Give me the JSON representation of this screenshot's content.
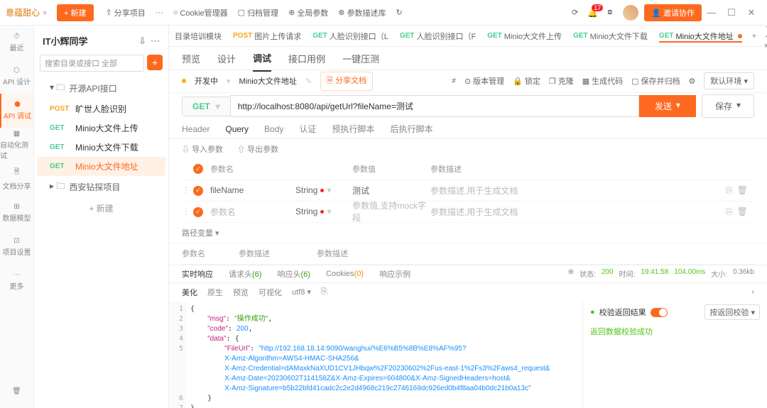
{
  "titlebar": {
    "workspace": "意蕴甜心",
    "new_btn": "新建",
    "share": "分享项目",
    "cookie": "Cookie管理器",
    "archive": "归档管理",
    "global": "全局参数",
    "paramdesc": "参数描述库",
    "notif_count": "17",
    "invite": "邀请协作"
  },
  "leftnav": {
    "recent": "最近",
    "design": "API 设计",
    "debug": "API 调试",
    "auto": "自动化测试",
    "docshare": "文档分享",
    "datamodel": "数据模型",
    "proj": "项目设置",
    "more": "更多"
  },
  "project": {
    "title": "IT小辉同学",
    "search_placeholder": "搜索目录或接口   全部",
    "folder": "开源API接口",
    "items": [
      {
        "method": "POST",
        "label": "旷世人脸识别"
      },
      {
        "method": "GET",
        "label": "Minio大文件上传"
      },
      {
        "method": "GET",
        "label": "Minio大文件下载"
      },
      {
        "method": "GET",
        "label": "Minio大文件地址"
      }
    ],
    "folder2": "西安钻探项目",
    "add": "新建"
  },
  "tabs": [
    {
      "method": "",
      "label": "目录培训模块"
    },
    {
      "method": "POST",
      "label": "图片上传请求"
    },
    {
      "method": "GET",
      "label": "人脸识别接口（L"
    },
    {
      "method": "GET",
      "label": "人脸识别接口（F"
    },
    {
      "method": "GET",
      "label": "Minio大文件上传"
    },
    {
      "method": "GET",
      "label": "Minio大文件下载"
    },
    {
      "method": "GET",
      "label": "Minio大文件地址"
    }
  ],
  "subtabs": {
    "preview": "预览",
    "design": "设计",
    "debug": "调试",
    "usecase": "接口用例",
    "press": "一键压测"
  },
  "meta": {
    "status": "开发中",
    "name": "Minio大文件地址",
    "share": "分享文档",
    "version": "版本管理",
    "lock": "锁定",
    "clone": "克隆",
    "gen": "生成代码",
    "archive": "保存并归档",
    "env": "默认环境"
  },
  "url": {
    "method": "GET",
    "value": "http://localhost:8080/api/getUrl?fileName=测试",
    "send": "发送",
    "save": "保存"
  },
  "paramtabs": {
    "header": "Header",
    "query": "Query",
    "body": "Body",
    "auth": "认证",
    "pre": "预执行脚本",
    "post": "后执行脚本"
  },
  "paramtools": {
    "import": "导入参数",
    "export": "导出参数"
  },
  "params": {
    "hd_name": "参数名",
    "hd_val": "参数值",
    "hd_desc": "参数描述",
    "rows": [
      {
        "name": "fileName",
        "type": "String",
        "val": "测试",
        "desc": "参数描述,用于生成文档"
      },
      {
        "name": "参数名",
        "type": "String",
        "val": "参数值,支持mock字段",
        "desc": "参数描述,用于生成文档"
      }
    ]
  },
  "pathvar": "路径变量",
  "secondHd": {
    "name": "参数名",
    "desc": "参数描述",
    "desc2": "参数描述"
  },
  "resulttabs": {
    "realtime": "实时响应",
    "reqhead": "请求头",
    "reqhead_n": "(6)",
    "reshead": "响应头",
    "reshead_n": "(6)",
    "cookies": "Cookies",
    "cookies_n": "(0)",
    "example": "响应示例"
  },
  "status": {
    "label": "状态:",
    "code": "200",
    "timelabel": "时间:",
    "time": "19:41:58",
    "ms": "104.00ms",
    "sizelabel": "大小:",
    "size": "0.36kb"
  },
  "viewrow": {
    "pretty": "美化",
    "raw": "原生",
    "preview": "预览",
    "visual": "可视化",
    "enc": "utf8"
  },
  "verify": {
    "head": "校验返回结果",
    "ok": "返回数据校验成功",
    "btn": "按返回校验"
  },
  "json": {
    "msg_k": "\"msg\"",
    "msg_v": "\"操作成功\"",
    "code_k": "\"code\"",
    "code_v": "200",
    "data_k": "\"data\"",
    "fileurl_k": "\"FileUrl\"",
    "fileurl_v": "\"http://192.168.18.14:9090/wanghui/%E6%B5%8B%E8%AF%95?",
    "l2": "X-Amz-Algorithm=AWS4-HMAC-SHA256&",
    "l3": "X-Amz-Credential=dAMaxkNaXUD1CV1JHbqw%2F20230602%2Fus-east-1%2Fs3%2Faws4_request&",
    "l4": "X-Amz-Date=20230602T114158Z&X-Amz-Expires=604800&X-Amz-SignedHeaders=host&",
    "l5": "X-Amz-Signature=b5b22bfd41cadc2c2e2d4968c219c2746169dc926ed0b4f8aa04b0dc21b0a13c\""
  }
}
